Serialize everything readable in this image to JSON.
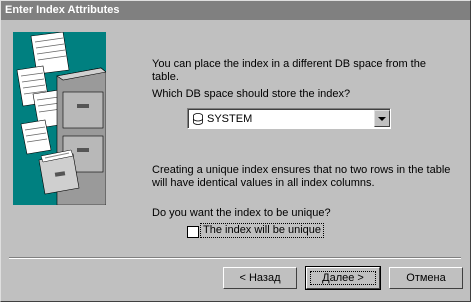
{
  "window": {
    "title": "Enter Index Attributes"
  },
  "content": {
    "line1a": "You can place the index in a different DB space from the",
    "line1b": "table.",
    "question_dbspace": "Which DB space should store the index?",
    "dbspace_value": "SYSTEM",
    "unique_info_a": "Creating a unique index ensures that no two rows in the table",
    "unique_info_b": "will have identical values in all index columns.",
    "question_unique": "Do you want the index to be unique?",
    "unique_checkbox_label": "The index will be unique",
    "unique_checked": false
  },
  "buttons": {
    "back": "< Назад",
    "next": "Далее >",
    "cancel": "Отмена"
  },
  "colors": {
    "titlebar": "#808080",
    "illustration_bg": "#008080",
    "dialog_bg": "#c0c0c0"
  }
}
